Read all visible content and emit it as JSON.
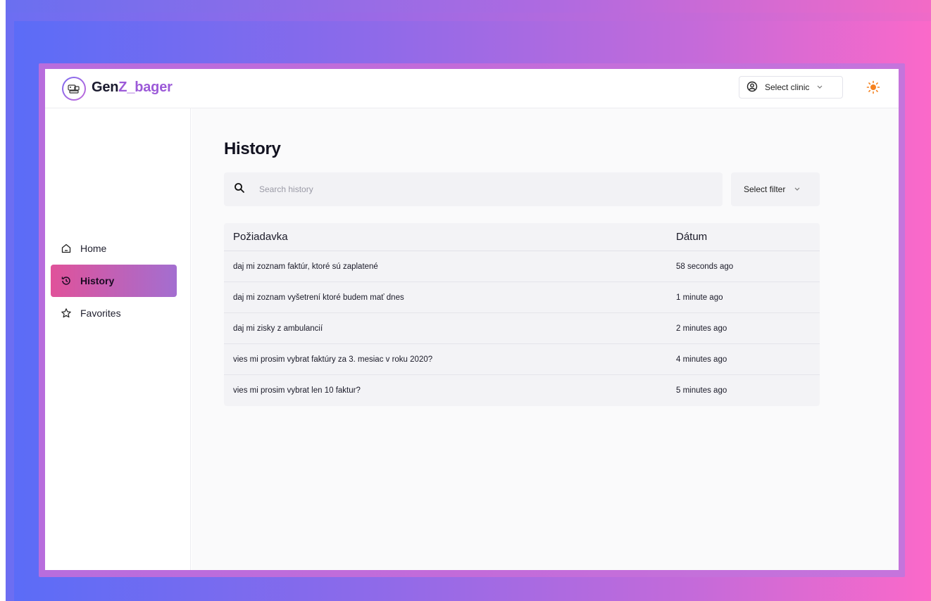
{
  "brand": {
    "prefix": "Gen",
    "accent": "Z_bager",
    "accent_color": "#9c5ad8",
    "logo_icon": "logo-icon"
  },
  "header": {
    "clinic_select": {
      "label": "Select clinic",
      "icon": "user-circle-icon"
    },
    "theme_toggle_icon": "sun-icon"
  },
  "sidebar": {
    "items": [
      {
        "label": "Home",
        "icon": "home-icon",
        "active": false
      },
      {
        "label": "History",
        "icon": "history-icon",
        "active": true
      },
      {
        "label": "Favorites",
        "icon": "star-icon",
        "active": false
      }
    ]
  },
  "page": {
    "title": "History",
    "search": {
      "placeholder": "Search history",
      "value": ""
    },
    "filter": {
      "label": "Select filter"
    }
  },
  "table": {
    "headers": [
      "Požiadavka",
      "Dátum"
    ],
    "rows": [
      {
        "request": "daj mi zoznam faktúr, ktoré sú zaplatené",
        "date": "58 seconds ago"
      },
      {
        "request": "daj mi zoznam vyšetrení ktoré budem mať dnes",
        "date": "1 minute ago"
      },
      {
        "request": "daj mi zisky z ambulancií",
        "date": "2 minutes ago"
      },
      {
        "request": "vies mi prosim vybrat faktúry za 3. mesiac v roku 2020?",
        "date": "4 minutes ago"
      },
      {
        "request": "vies mi prosim vybrat len 10 faktur?",
        "date": "5 minutes ago"
      }
    ]
  },
  "colors": {
    "active_gradient_start": "#e0529a",
    "active_gradient_end": "#a36ed0",
    "sun": "#f5821f"
  }
}
